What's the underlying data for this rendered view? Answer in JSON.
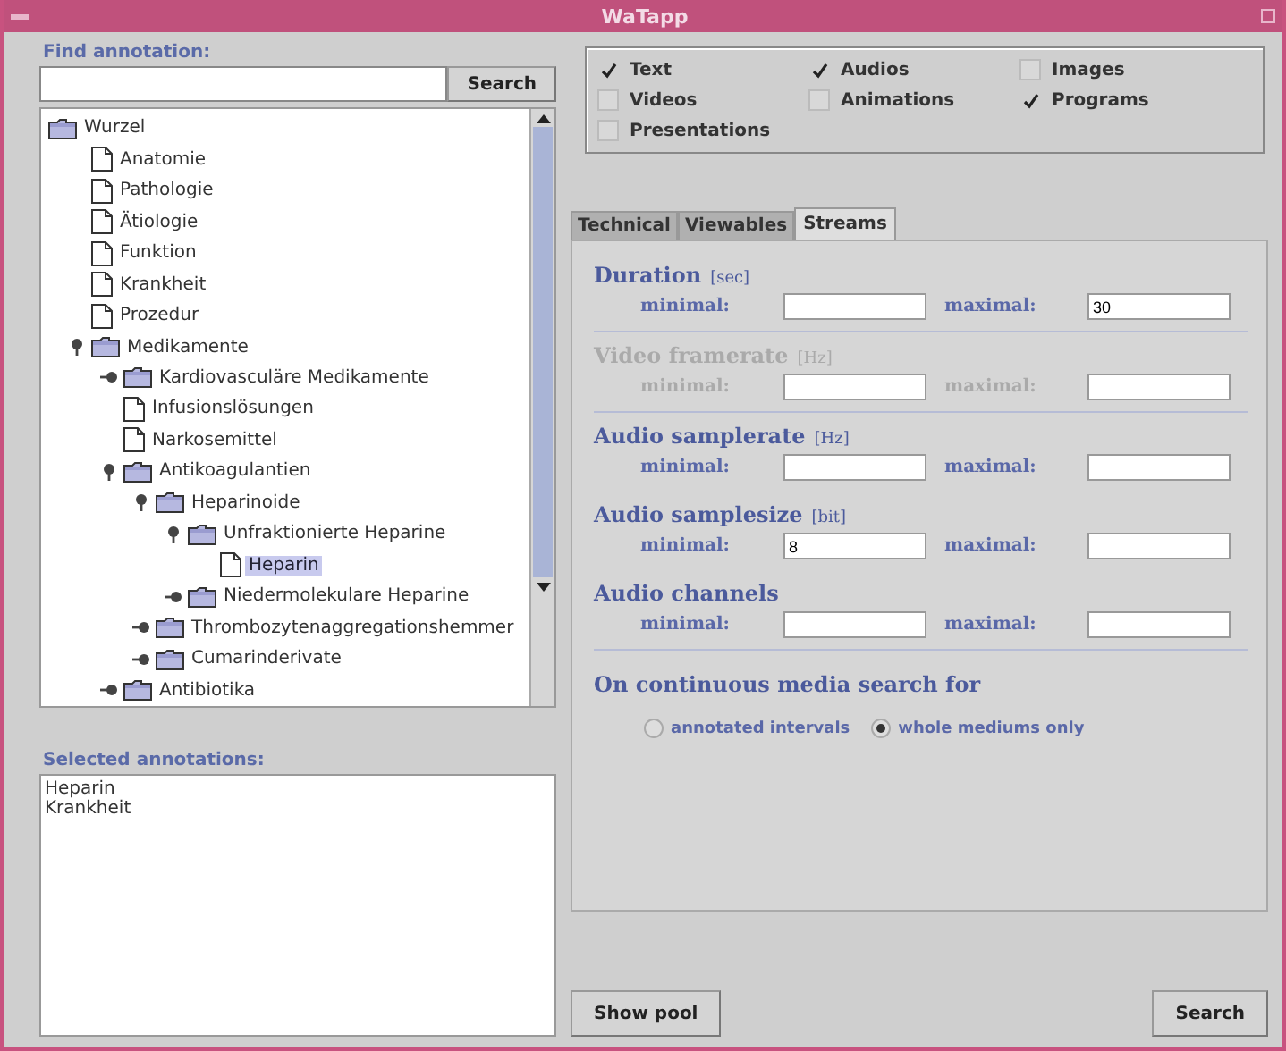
{
  "window": {
    "title": "WaTapp"
  },
  "find": {
    "label": "Find annotation:",
    "button": "Search"
  },
  "tree": {
    "label": "Wurzel",
    "kind": "folder",
    "selected": false,
    "children": [
      {
        "label": "Anatomie",
        "kind": "leaf",
        "selected": false
      },
      {
        "label": "Pathologie",
        "kind": "leaf",
        "selected": false
      },
      {
        "label": "Ätiologie",
        "kind": "leaf",
        "selected": false
      },
      {
        "label": "Funktion",
        "kind": "leaf",
        "selected": false
      },
      {
        "label": "Krankheit",
        "kind": "leaf",
        "selected": false
      },
      {
        "label": "Prozedur",
        "kind": "leaf",
        "selected": false
      },
      {
        "label": "Medikamente",
        "kind": "folder",
        "expanded": true,
        "selected": false,
        "children": [
          {
            "label": "Kardiovasculäre Medikamente",
            "kind": "folder",
            "expanded": false,
            "selected": false
          },
          {
            "label": "Infusionslösungen",
            "kind": "leaf",
            "selected": false
          },
          {
            "label": "Narkosemittel",
            "kind": "leaf",
            "selected": false
          },
          {
            "label": "Antikoagulantien",
            "kind": "folder",
            "expanded": true,
            "selected": false,
            "children": [
              {
                "label": "Heparinoide",
                "kind": "folder",
                "expanded": true,
                "selected": false,
                "children": [
                  {
                    "label": "Unfraktionierte Heparine",
                    "kind": "folder",
                    "expanded": true,
                    "selected": false,
                    "children": [
                      {
                        "label": "Heparin",
                        "kind": "leaf",
                        "selected": true
                      }
                    ]
                  },
                  {
                    "label": "Niedermolekulare Heparine",
                    "kind": "folder",
                    "expanded": false,
                    "selected": false
                  }
                ]
              },
              {
                "label": "Thrombozytenaggregationshemmer",
                "kind": "folder",
                "expanded": false,
                "selected": false
              },
              {
                "label": "Cumarinderivate",
                "kind": "folder",
                "expanded": false,
                "selected": false
              }
            ]
          },
          {
            "label": "Antibiotika",
            "kind": "folder",
            "expanded": false,
            "selected": false
          }
        ]
      }
    ]
  },
  "selected_annotations": {
    "label": "Selected annotations:",
    "items": [
      "Heparin",
      "Krankheit"
    ]
  },
  "media_types": [
    {
      "label": "Text",
      "checked": true
    },
    {
      "label": "Audios",
      "checked": true
    },
    {
      "label": "Images",
      "checked": false
    },
    {
      "label": "Videos",
      "checked": false
    },
    {
      "label": "Animations",
      "checked": false
    },
    {
      "label": "Programs",
      "checked": true
    },
    {
      "label": "Presentations",
      "checked": false
    }
  ],
  "tabs": [
    {
      "label": "Technical",
      "selected": false
    },
    {
      "label": "Viewables",
      "selected": false
    },
    {
      "label": "Streams",
      "selected": true
    }
  ],
  "ranges": [
    {
      "title": "Duration",
      "unit": "[sec]",
      "disabled": false,
      "min_label": "minimal:",
      "max_label": "maximal:",
      "max": "30",
      "divider": true
    },
    {
      "title": "Video framerate",
      "unit": "[Hz]",
      "disabled": true,
      "min_label": "minimal:",
      "max_label": "maximal:",
      "divider": true
    },
    {
      "title": "Audio samplerate",
      "unit": "[Hz]",
      "disabled": false,
      "min_label": "minimal:",
      "max_label": "maximal:",
      "divider": false
    },
    {
      "title": "Audio samplesize",
      "unit": "[bit]",
      "disabled": false,
      "min_label": "minimal:",
      "min": "8",
      "max_label": "maximal:",
      "divider": false
    },
    {
      "title": "Audio channels",
      "disabled": false,
      "min_label": "minimal:",
      "max_label": "maximal:",
      "divider": true
    }
  ],
  "continuous": {
    "label": "On continuous media search for",
    "options": [
      {
        "label": "annotated intervals",
        "selected": false
      },
      {
        "label": "whole mediums only",
        "selected": true
      }
    ]
  },
  "buttons": {
    "show_pool": "Show pool",
    "search": "Search"
  }
}
